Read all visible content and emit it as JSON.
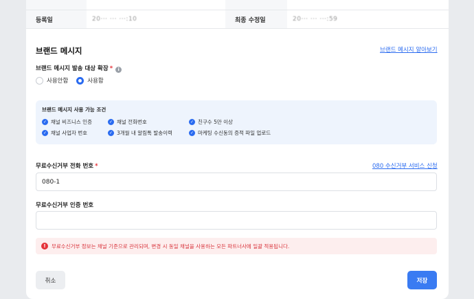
{
  "info_table": {
    "registered_label": "등록일",
    "registered_value": "20··· ··· ···:10",
    "modified_label": "최종 수정일",
    "modified_value": "20··· ··· ···:59"
  },
  "brand_message": {
    "title": "브랜드 메시지",
    "learn_more_link": "브랜드 메시지 알아보기",
    "expand_label": "브랜드 메시지 발송 대상 확장",
    "required_mark": "*",
    "options": [
      {
        "label": "사용안함",
        "selected": false
      },
      {
        "label": "사용함",
        "selected": true
      }
    ],
    "conditions": {
      "title": "브랜드 메시지 사용 가능 조건",
      "items": [
        "채널 비즈니스 인증",
        "채널 전화번호",
        "친구수 5만 이상",
        "채널 사업자 번호",
        "3개월 내 알림톡 발송이력",
        "마케팅 수신동의 증적 파일 업로드"
      ]
    }
  },
  "opt_out": {
    "phone_label": "무료수신거부 전화 번호",
    "required_mark": "*",
    "service_link": "080 수신거부 서비스 신청",
    "phone_value": "080-1",
    "auth_label": "무료수신거부 인증 번호",
    "auth_value": ""
  },
  "alert": {
    "icon": "!",
    "text": "무료수신거부 정보는 채널 기준으로 관리되며, 변경 시 동일 채널을 사용하는 모든 파트너사에 일괄 적용됩니다."
  },
  "actions": {
    "cancel_label": "취소",
    "save_label": "저장"
  },
  "colors": {
    "accent": "#2a6bf0",
    "button_primary": "#3a7bf2",
    "alert_bg": "#fdeeee",
    "alert_text": "#d9363e",
    "condition_bg": "#eef4fd"
  }
}
